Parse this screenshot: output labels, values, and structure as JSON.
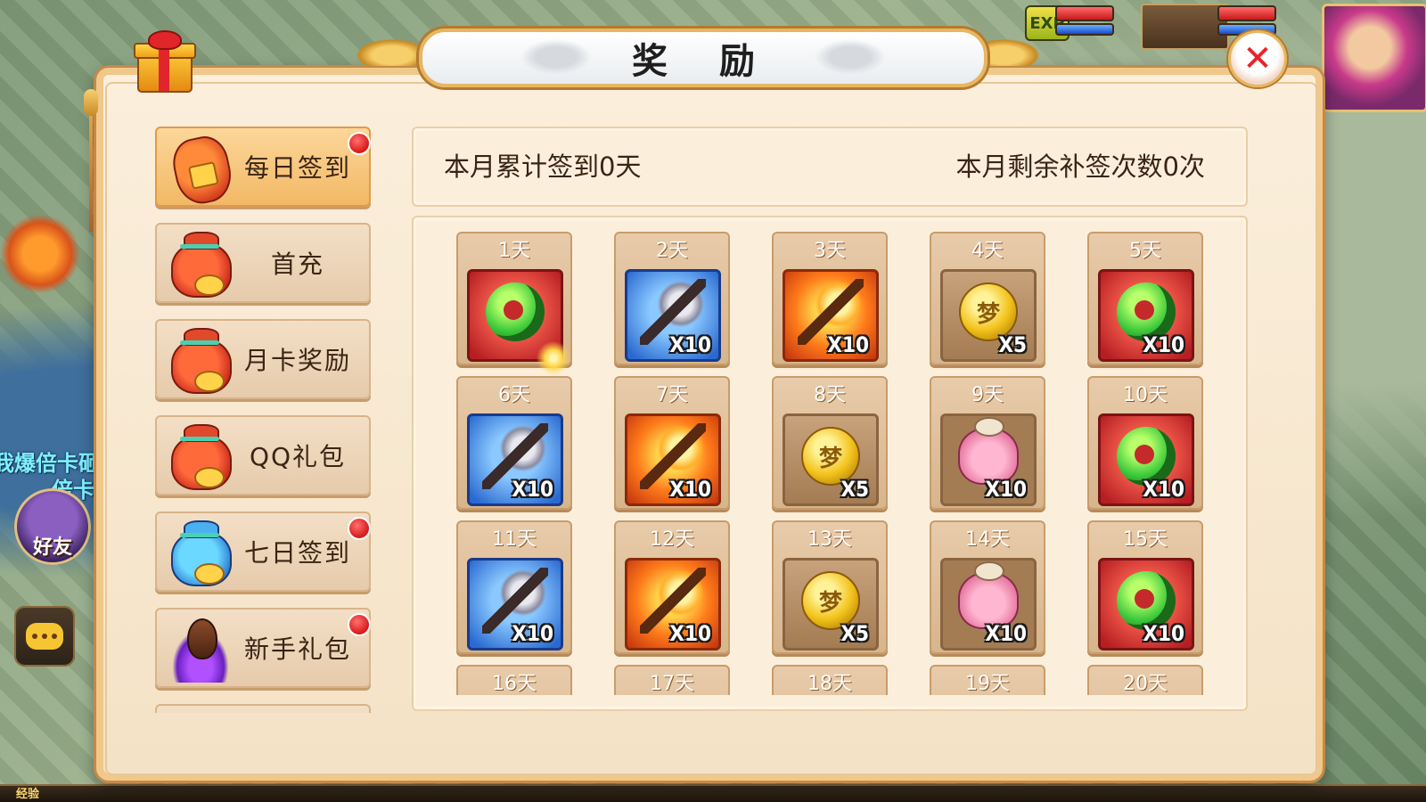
{
  "panel": {
    "title": "奖 励",
    "close_icon": "close-icon",
    "accent_color": "#f0c88a"
  },
  "hud": {
    "exp_badge": "EXP",
    "exp_bar_label": "经验"
  },
  "background": {
    "text_line1": "我爆倍卡砸",
    "text_line2": "倍卡",
    "friend_button": "好友",
    "chat_icon": "chat-icon"
  },
  "menu": {
    "items": [
      {
        "label": "每日签到",
        "icon": "red-lantern-icon",
        "active": true,
        "notify": true
      },
      {
        "label": "首充",
        "icon": "red-bag-icon",
        "active": false,
        "notify": false
      },
      {
        "label": "月卡奖励",
        "icon": "red-bag-icon",
        "active": false,
        "notify": false
      },
      {
        "label": "QQ礼包",
        "icon": "red-bag-icon",
        "active": false,
        "notify": false
      },
      {
        "label": "七日签到",
        "icon": "blue-bag-icon",
        "active": false,
        "notify": true
      },
      {
        "label": "新手礼包",
        "icon": "egg-icon",
        "active": false,
        "notify": true
      },
      {
        "label": "",
        "icon": "red-bag-icon",
        "active": false,
        "notify": false
      }
    ]
  },
  "signin": {
    "monthly_count": "本月累计签到0天",
    "makeup_remaining": "本月剩余补签次数0次"
  },
  "rewards": [
    {
      "day": "1天",
      "item": "jade",
      "bg": "red",
      "qty": ""
    },
    {
      "day": "2天",
      "item": "mace",
      "bg": "blue",
      "qty": "X10"
    },
    {
      "day": "3天",
      "item": "mace",
      "bg": "orange",
      "qty": "X10"
    },
    {
      "day": "4天",
      "item": "coin",
      "bg": "brown",
      "qty": "X5"
    },
    {
      "day": "5天",
      "item": "jade",
      "bg": "red",
      "qty": "X10"
    },
    {
      "day": "6天",
      "item": "mace",
      "bg": "blue",
      "qty": "X10"
    },
    {
      "day": "7天",
      "item": "mace",
      "bg": "orange",
      "qty": "X10"
    },
    {
      "day": "8天",
      "item": "coin",
      "bg": "brown",
      "qty": "X5"
    },
    {
      "day": "9天",
      "item": "pig",
      "bg": "brown2",
      "qty": "X10"
    },
    {
      "day": "10天",
      "item": "jade",
      "bg": "red",
      "qty": "X10"
    },
    {
      "day": "11天",
      "item": "mace",
      "bg": "blue",
      "qty": "X10"
    },
    {
      "day": "12天",
      "item": "mace",
      "bg": "orange",
      "qty": "X10"
    },
    {
      "day": "13天",
      "item": "coin",
      "bg": "brown",
      "qty": "X5"
    },
    {
      "day": "14天",
      "item": "pig",
      "bg": "brown2",
      "qty": "X10"
    },
    {
      "day": "15天",
      "item": "jade",
      "bg": "red",
      "qty": "X10"
    },
    {
      "day": "16天",
      "item": "",
      "bg": "brown",
      "qty": ""
    },
    {
      "day": "17天",
      "item": "",
      "bg": "brown",
      "qty": ""
    },
    {
      "day": "18天",
      "item": "",
      "bg": "brown",
      "qty": ""
    },
    {
      "day": "19天",
      "item": "",
      "bg": "brown",
      "qty": ""
    },
    {
      "day": "20天",
      "item": "",
      "bg": "brown",
      "qty": ""
    }
  ],
  "coin_glyph": "梦"
}
